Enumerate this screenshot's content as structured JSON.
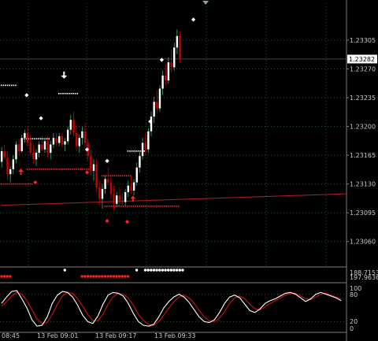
{
  "colors": {
    "background": "#000000",
    "grid": "#2f4f2f",
    "axis_text": "#c8c8c8",
    "bull_candle": "#ffffff",
    "bear_candle": "#cc0000",
    "wick_up": "#3cb371",
    "ma_line": "#b22222",
    "price_label_bg": "#ffffff",
    "price_label_fg": "#000000",
    "stoch_main": "#ffffff",
    "stoch_signal": "#d01010",
    "white_dot": "#ffffff",
    "red_dot": "#ff2020",
    "arrow_up": "#ff2020",
    "arrow_down": "#ffffff",
    "top_marker": "#8aa0b0"
  },
  "chart_data": [
    {
      "type": "candlestick",
      "panel": "main",
      "title": "",
      "y_ticks": [
        "1.23305",
        "1.23270",
        "1.23235",
        "1.23200",
        "1.23165",
        "1.23130",
        "1.23095",
        "1.23060"
      ],
      "ylim": [
        1.2303,
        1.2335
      ],
      "current_price": "1.23282",
      "current_price_value": 1.23282,
      "candles": [
        [
          1.23157,
          1.23175,
          1.2315,
          1.2317
        ],
        [
          1.2317,
          1.23178,
          1.2316,
          1.23162
        ],
        [
          1.23162,
          1.2317,
          1.23135,
          1.23142
        ],
        [
          1.23142,
          1.23152,
          1.23132,
          1.23148
        ],
        [
          1.23148,
          1.23165,
          1.23142,
          1.2316
        ],
        [
          1.2316,
          1.23182,
          1.23155,
          1.23178
        ],
        [
          1.23178,
          1.23185,
          1.23165,
          1.2317
        ],
        [
          1.2317,
          1.2319,
          1.23168,
          1.23186
        ],
        [
          1.23186,
          1.23196,
          1.2318,
          1.23192
        ],
        [
          1.23192,
          1.232,
          1.23176,
          1.2318
        ],
        [
          1.2318,
          1.2319,
          1.23165,
          1.23168
        ],
        [
          1.23168,
          1.23178,
          1.23155,
          1.2316
        ],
        [
          1.2316,
          1.23172,
          1.23152,
          1.23168
        ],
        [
          1.23168,
          1.23182,
          1.23162,
          1.23178
        ],
        [
          1.23178,
          1.23188,
          1.2317,
          1.23172
        ],
        [
          1.23172,
          1.23186,
          1.23168,
          1.23182
        ],
        [
          1.23182,
          1.23188,
          1.23162,
          1.23168
        ],
        [
          1.23168,
          1.23182,
          1.2316,
          1.23178
        ],
        [
          1.23178,
          1.23192,
          1.23174,
          1.23186
        ],
        [
          1.23186,
          1.23192,
          1.23176,
          1.2318
        ],
        [
          1.2318,
          1.23192,
          1.23176,
          1.23188
        ],
        [
          1.23188,
          1.23192,
          1.23175,
          1.23178
        ],
        [
          1.23178,
          1.23186,
          1.2317,
          1.23182
        ],
        [
          1.23182,
          1.232,
          1.23178,
          1.23196
        ],
        [
          1.23196,
          1.23214,
          1.2319,
          1.23208
        ],
        [
          1.23208,
          1.23218,
          1.23188,
          1.23192
        ],
        [
          1.23192,
          1.23202,
          1.2317,
          1.23176
        ],
        [
          1.23176,
          1.2319,
          1.23168,
          1.23186
        ],
        [
          1.23186,
          1.232,
          1.23178,
          1.23194
        ],
        [
          1.23194,
          1.23204,
          1.23176,
          1.2318
        ],
        [
          1.2318,
          1.23186,
          1.23158,
          1.23164
        ],
        [
          1.23164,
          1.23172,
          1.2314,
          1.23146
        ],
        [
          1.23146,
          1.2316,
          1.23134,
          1.23154
        ],
        [
          1.23154,
          1.2316,
          1.2312,
          1.23126
        ],
        [
          1.23126,
          1.23134,
          1.23104,
          1.23112
        ],
        [
          1.23112,
          1.2313,
          1.231,
          1.23124
        ],
        [
          1.23124,
          1.2314,
          1.23118,
          1.23136
        ],
        [
          1.23136,
          1.2315,
          1.23128,
          1.23132
        ],
        [
          1.23132,
          1.2314,
          1.23112,
          1.23118
        ],
        [
          1.23118,
          1.23128,
          1.23098,
          1.23106
        ],
        [
          1.23106,
          1.2312,
          1.23102,
          1.23116
        ],
        [
          1.23116,
          1.23126,
          1.23104,
          1.2311
        ],
        [
          1.2311,
          1.2312,
          1.23104,
          1.23108
        ],
        [
          1.23108,
          1.23124,
          1.23104,
          1.2312
        ],
        [
          1.2312,
          1.23134,
          1.23114,
          1.23128
        ],
        [
          1.23128,
          1.2314,
          1.23118,
          1.23122
        ],
        [
          1.23122,
          1.23136,
          1.23116,
          1.23132
        ],
        [
          1.23132,
          1.23156,
          1.23128,
          1.2315
        ],
        [
          1.2315,
          1.2317,
          1.23144,
          1.23164
        ],
        [
          1.23164,
          1.23186,
          1.2316,
          1.2318
        ],
        [
          1.2318,
          1.23192,
          1.23166,
          1.23172
        ],
        [
          1.23172,
          1.23198,
          1.23168,
          1.23194
        ],
        [
          1.23194,
          1.23218,
          1.23188,
          1.23212
        ],
        [
          1.23212,
          1.23236,
          1.23204,
          1.2323
        ],
        [
          1.2323,
          1.23244,
          1.23216,
          1.23222
        ],
        [
          1.23222,
          1.2325,
          1.23218,
          1.23246
        ],
        [
          1.23246,
          1.23268,
          1.23238,
          1.23262
        ],
        [
          1.23262,
          1.23276,
          1.2325,
          1.23256
        ],
        [
          1.23256,
          1.23284,
          1.23252,
          1.23278
        ],
        [
          1.23278,
          1.23294,
          1.23266,
          1.23272
        ],
        [
          1.23272,
          1.23302,
          1.23268,
          1.23296
        ],
        [
          1.23296,
          1.23318,
          1.23288,
          1.2331
        ],
        [
          1.2331,
          1.23316,
          1.23278,
          1.23282
        ]
      ],
      "ma_line": [
        [
          0,
          1.23104
        ],
        [
          120,
          1.23118
        ]
      ],
      "white_dot_lines": [
        {
          "from": 0,
          "to": 5,
          "value": 1.2325
        },
        {
          "from": 20,
          "to": 27,
          "value": 1.2324
        },
        {
          "from": 8,
          "to": 17,
          "value": 1.23185
        },
        {
          "from": 44,
          "to": 50,
          "value": 1.2317
        }
      ],
      "red_dot_lines": [
        {
          "from": 0,
          "to": 11,
          "value": 1.2313
        },
        {
          "from": 9,
          "to": 31,
          "value": 1.23148
        },
        {
          "from": 35,
          "to": 45,
          "value": 1.2314
        },
        {
          "from": 36,
          "to": 62,
          "value": 1.23103
        }
      ],
      "white_diamonds": [
        [
          9,
          1.23238
        ],
        [
          14,
          1.2321
        ],
        [
          30,
          1.23172
        ],
        [
          37,
          1.23158
        ],
        [
          52,
          1.23206
        ],
        [
          56,
          1.23281
        ],
        [
          67,
          1.2333
        ]
      ],
      "red_diamonds": [
        [
          12,
          1.23132
        ],
        [
          37,
          1.23085
        ],
        [
          44,
          1.23084
        ],
        [
          30,
          1.23144
        ]
      ],
      "arrows_up": [
        [
          7,
          1.23145
        ],
        [
          46,
          1.23112
        ]
      ],
      "arrows_down": [
        [
          22,
          1.23262
        ]
      ],
      "top_marker_index": 71
    },
    {
      "type": "dots",
      "panel": "signal_strip",
      "y_ticks": [
        "188.7153",
        "197.9636"
      ],
      "white_dots": [
        22,
        47,
        50,
        51,
        52,
        53,
        54,
        55,
        56,
        57,
        58,
        59,
        60,
        61,
        62,
        63
      ],
      "red_dots": [
        0,
        1,
        2,
        3,
        28,
        29,
        30,
        31,
        32,
        33,
        34,
        35,
        36,
        37,
        38,
        39,
        40,
        41,
        42,
        43,
        44
      ],
      "small_red_dots": [
        0
      ]
    },
    {
      "type": "line",
      "panel": "stochastic",
      "y_ticks": [
        "100",
        "80",
        "20",
        "0"
      ],
      "ylim": [
        0,
        100
      ],
      "levels": [
        80,
        20
      ],
      "series": [
        {
          "key": "main",
          "values": [
            60,
            74,
            86,
            88,
            70,
            50,
            24,
            10,
            12,
            30,
            60,
            78,
            86,
            84,
            74,
            56,
            34,
            20,
            16,
            32,
            58,
            78,
            84,
            82,
            76,
            60,
            38,
            20,
            12,
            10,
            14,
            30,
            50,
            64,
            74,
            80,
            74,
            62,
            46,
            30,
            20,
            18,
            24,
            40,
            60,
            74,
            78,
            72,
            58,
            44,
            40,
            48,
            60,
            66,
            70,
            76,
            82,
            84,
            80,
            72,
            64,
            70,
            80,
            84,
            80,
            76,
            72,
            66
          ]
        },
        {
          "key": "signal",
          "values": [
            54,
            64,
            76,
            84,
            80,
            66,
            46,
            26,
            16,
            18,
            36,
            58,
            76,
            84,
            82,
            70,
            54,
            36,
            22,
            22,
            36,
            58,
            74,
            82,
            80,
            72,
            56,
            36,
            22,
            14,
            12,
            20,
            34,
            50,
            64,
            74,
            78,
            72,
            60,
            44,
            30,
            22,
            20,
            28,
            42,
            60,
            72,
            76,
            70,
            58,
            48,
            46,
            52,
            60,
            66,
            72,
            78,
            82,
            82,
            76,
            70,
            68,
            74,
            80,
            82,
            78,
            74,
            70
          ]
        }
      ]
    }
  ],
  "x_axis": {
    "labels": [
      "08:45",
      "13 Feb 09:01",
      "13 Feb 09:17",
      "13 Feb 09:33"
    ],
    "label_indices": [
      0,
      23,
      47,
      71
    ]
  }
}
